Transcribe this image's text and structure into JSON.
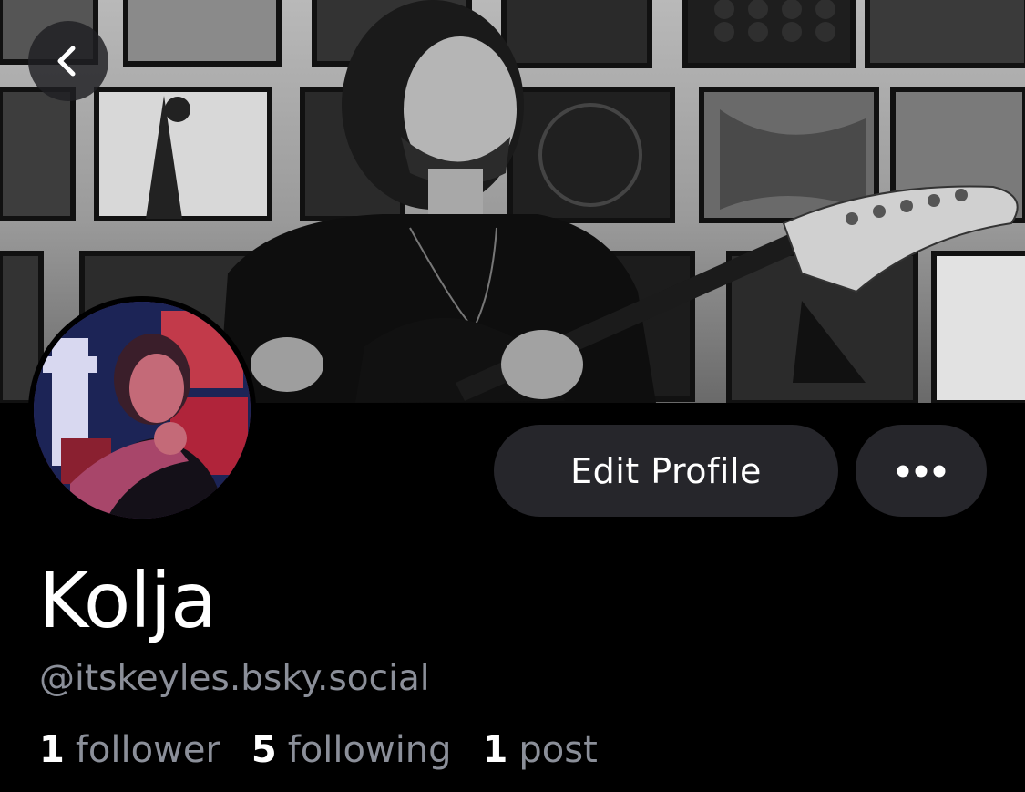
{
  "header": {
    "back_icon": "chevron-left-icon"
  },
  "profile": {
    "display_name": "Kolja",
    "handle": "@itskeyles.bsky.social",
    "edit_label": "Edit Profile",
    "more_icon": "ellipsis-icon"
  },
  "stats": {
    "followers": {
      "count": "1",
      "label": "follower"
    },
    "following": {
      "count": "5",
      "label": "following"
    },
    "posts": {
      "count": "1",
      "label": "post"
    }
  },
  "colors": {
    "background": "#000000",
    "button_bg": "#26262b",
    "muted_text": "#8b8f99"
  }
}
